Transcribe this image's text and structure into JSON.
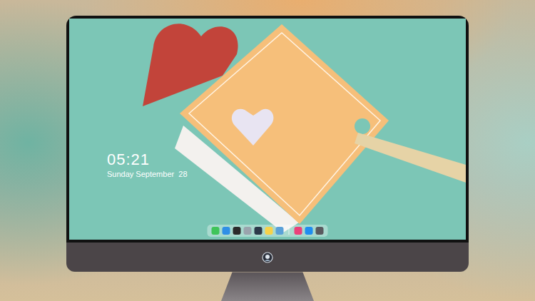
{
  "screen": {
    "clock": "05:21",
    "date": "Sunday September  28"
  },
  "dock": {
    "apps": [
      {
        "name": "messages",
        "color": "#3fc45a"
      },
      {
        "name": "files",
        "color": "#2f8fe6"
      },
      {
        "name": "browser",
        "color": "#2b2b2b"
      },
      {
        "name": "preview",
        "color": "#9aa4ad"
      },
      {
        "name": "video",
        "color": "#2d3a4a"
      },
      {
        "name": "notes",
        "color": "#f6d24a"
      },
      {
        "name": "photos",
        "color": "#5aa1d8"
      }
    ],
    "pinned": [
      {
        "name": "music",
        "color": "#e9417a"
      },
      {
        "name": "store",
        "color": "#1f8ef0"
      },
      {
        "name": "camera",
        "color": "#5a5a5f"
      }
    ]
  }
}
